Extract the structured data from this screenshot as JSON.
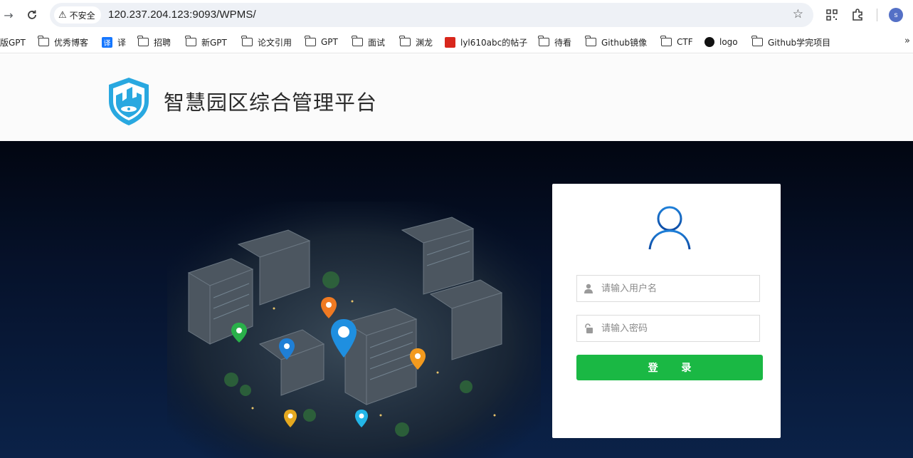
{
  "browser": {
    "security_label": "不安全",
    "url": "120.237.204.123:9093/WPMS/",
    "avatar_letter": "s"
  },
  "bookmarks": [
    {
      "label": "版GPT",
      "icon": "folder-icon"
    },
    {
      "label": "优秀博客",
      "icon": "folder-icon"
    },
    {
      "label": "译",
      "icon": "translate-icon"
    },
    {
      "label": "招聘",
      "icon": "folder-icon"
    },
    {
      "label": "新GPT",
      "icon": "folder-icon"
    },
    {
      "label": "论文引用",
      "icon": "folder-icon"
    },
    {
      "label": "GPT",
      "icon": "folder-icon"
    },
    {
      "label": "面试",
      "icon": "folder-icon"
    },
    {
      "label": "渊龙",
      "icon": "folder-icon"
    },
    {
      "label": "lyl610abc的帖子",
      "icon": "red-site-icon"
    },
    {
      "label": "待看",
      "icon": "folder-icon"
    },
    {
      "label": "Github镜像",
      "icon": "folder-icon"
    },
    {
      "label": "CTF",
      "icon": "folder-icon"
    },
    {
      "label": "logo",
      "icon": "apple-icon"
    },
    {
      "label": "Github学完项目",
      "icon": "folder-icon"
    }
  ],
  "header": {
    "title": "智慧园区综合管理平台"
  },
  "login": {
    "username_placeholder": "请输入用户名",
    "password_placeholder": "请输入密码",
    "submit_label": "登 录"
  },
  "colors": {
    "accent_green": "#1ab844",
    "logo_blue": "#29a8e0",
    "hero_dark": "#020611"
  }
}
